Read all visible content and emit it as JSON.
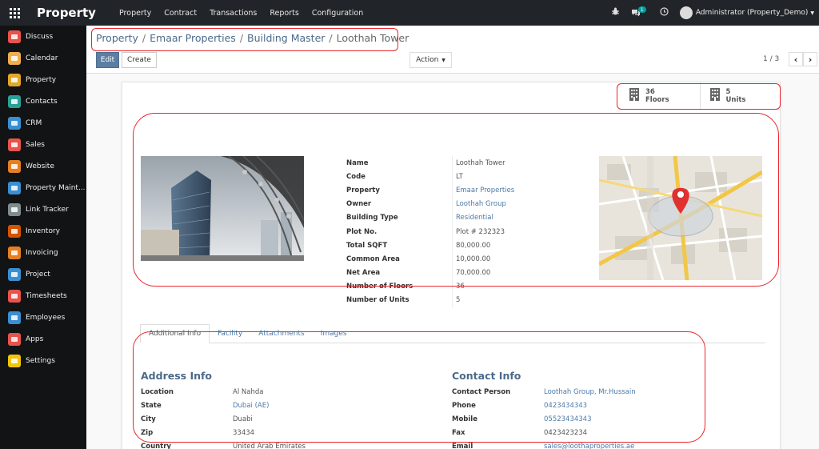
{
  "topbar": {
    "brand": "Property",
    "menu": [
      "Property",
      "Contract",
      "Transactions",
      "Reports",
      "Configuration"
    ],
    "chat_badge": "1",
    "user": "Administrator (Property_Demo)"
  },
  "sidebar": {
    "items": [
      {
        "label": "Discuss",
        "icon": "chat-icon",
        "color": "#e8534b"
      },
      {
        "label": "Calendar",
        "icon": "calendar-icon",
        "color": "#f0ad4e"
      },
      {
        "label": "Property",
        "icon": "property-icon",
        "color": "#e2a82a"
      },
      {
        "label": "Contacts",
        "icon": "contacts-icon",
        "color": "#2aa198"
      },
      {
        "label": "CRM",
        "icon": "crm-icon",
        "color": "#3b8fd1"
      },
      {
        "label": "Sales",
        "icon": "sales-icon",
        "color": "#e8534b"
      },
      {
        "label": "Website",
        "icon": "website-icon",
        "color": "#e67e22"
      },
      {
        "label": "Property Maint...",
        "icon": "maintenance-icon",
        "color": "#3b8fd1"
      },
      {
        "label": "Link Tracker",
        "icon": "link-icon",
        "color": "#7f8c8d"
      },
      {
        "label": "Inventory",
        "icon": "inventory-icon",
        "color": "#d35400"
      },
      {
        "label": "Invoicing",
        "icon": "invoicing-icon",
        "color": "#e67e22"
      },
      {
        "label": "Project",
        "icon": "project-icon",
        "color": "#3b8fd1"
      },
      {
        "label": "Timesheets",
        "icon": "timesheet-icon",
        "color": "#e8534b"
      },
      {
        "label": "Employees",
        "icon": "employees-icon",
        "color": "#3b8fd1"
      },
      {
        "label": "Apps",
        "icon": "apps-icon",
        "color": "#e8534b"
      },
      {
        "label": "Settings",
        "icon": "settings-icon",
        "color": "#f1c40f"
      }
    ]
  },
  "breadcrumb": {
    "items": [
      "Property",
      "Emaar Properties",
      "Building Master",
      "Loothah Tower"
    ],
    "separator": "/"
  },
  "buttons": {
    "edit": "Edit",
    "create": "Create",
    "action": "Action"
  },
  "pager": {
    "value": "1 / 3"
  },
  "stats": {
    "floors": {
      "count": "36",
      "label": "Floors"
    },
    "units": {
      "count": "5",
      "label": "Units"
    }
  },
  "fields": [
    {
      "label": "Name",
      "value": "Loothah Tower",
      "link": false
    },
    {
      "label": "Code",
      "value": "LT",
      "link": false
    },
    {
      "label": "Property",
      "value": "Emaar Properties",
      "link": true
    },
    {
      "label": "Owner",
      "value": "Loothah Group",
      "link": true
    },
    {
      "label": "Building Type",
      "value": "Residential",
      "link": true
    },
    {
      "label": "Plot No.",
      "value": "Plot # 232323",
      "link": false
    },
    {
      "label": "Total SQFT",
      "value": "80,000.00",
      "link": false
    },
    {
      "label": "Common Area",
      "value": "10,000.00",
      "link": false
    },
    {
      "label": "Net Area",
      "value": "70,000.00",
      "link": false
    },
    {
      "label": "Number of Floors",
      "value": "36",
      "link": false
    },
    {
      "label": "Number of Units",
      "value": "5",
      "link": false
    }
  ],
  "tabs": [
    "Additional Info",
    "Facility",
    "Attachments",
    "Images"
  ],
  "address": {
    "title": "Address Info",
    "rows": [
      {
        "label": "Location",
        "value": "Al Nahda",
        "link": false
      },
      {
        "label": "State",
        "value": "Dubai (AE)",
        "link": true
      },
      {
        "label": "City",
        "value": "Duabi",
        "link": false
      },
      {
        "label": "Zip",
        "value": "33434",
        "link": false
      },
      {
        "label": "Country",
        "value": "United Arab Emirates",
        "link": false
      }
    ]
  },
  "contact": {
    "title": "Contact Info",
    "rows": [
      {
        "label": "Contact Person",
        "value": "Loothah Group, Mr.Hussain",
        "link": true
      },
      {
        "label": "Phone",
        "value": "0423434343",
        "link": true
      },
      {
        "label": "Mobile",
        "value": "05523434343",
        "link": true
      },
      {
        "label": "Fax",
        "value": "0423423234",
        "link": false
      },
      {
        "label": "Email",
        "value": "sales@loothaproperties.ae",
        "link": true
      }
    ]
  },
  "colors": {
    "topbar": "#212529",
    "sidebar": "#121314",
    "link": "#4c7aa8",
    "edit_button": "#5b7fa2",
    "annotation": "#e8262c"
  }
}
